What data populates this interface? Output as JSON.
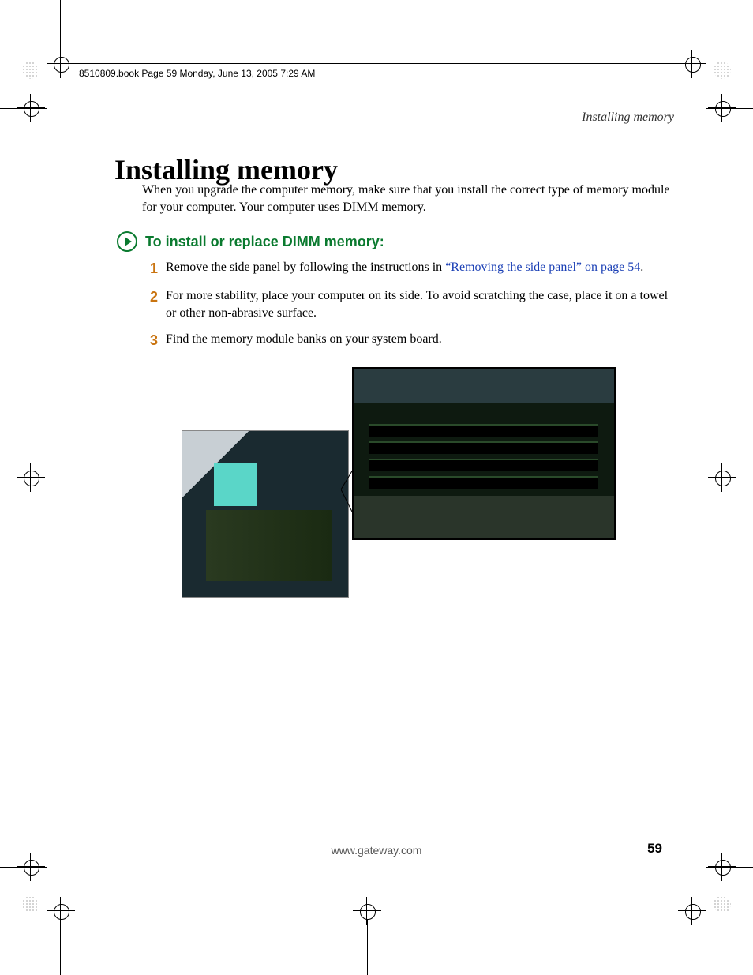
{
  "source_line": "8510809.book  Page 59  Monday, June 13, 2005  7:29 AM",
  "running_head": "Installing memory",
  "heading": "Installing memory",
  "intro": "When you upgrade the computer memory, make sure that you install the correct type of memory module for your computer. Your computer uses DIMM memory.",
  "procedure_heading": "To install or replace DIMM memory:",
  "steps": {
    "s1_pre": "Remove the side panel by following the instructions in ",
    "s1_link": "“Removing the side panel” on page 54",
    "s1_post": ".",
    "s2": "For more stability, place your computer on its side. To avoid scratching the case, place it on a towel or other non-abrasive surface.",
    "s3": "Find the memory module banks on your system board."
  },
  "step_numbers": {
    "n1": "1",
    "n2": "2",
    "n3": "3"
  },
  "footer_url": "www.gateway.com",
  "page_number": "59"
}
